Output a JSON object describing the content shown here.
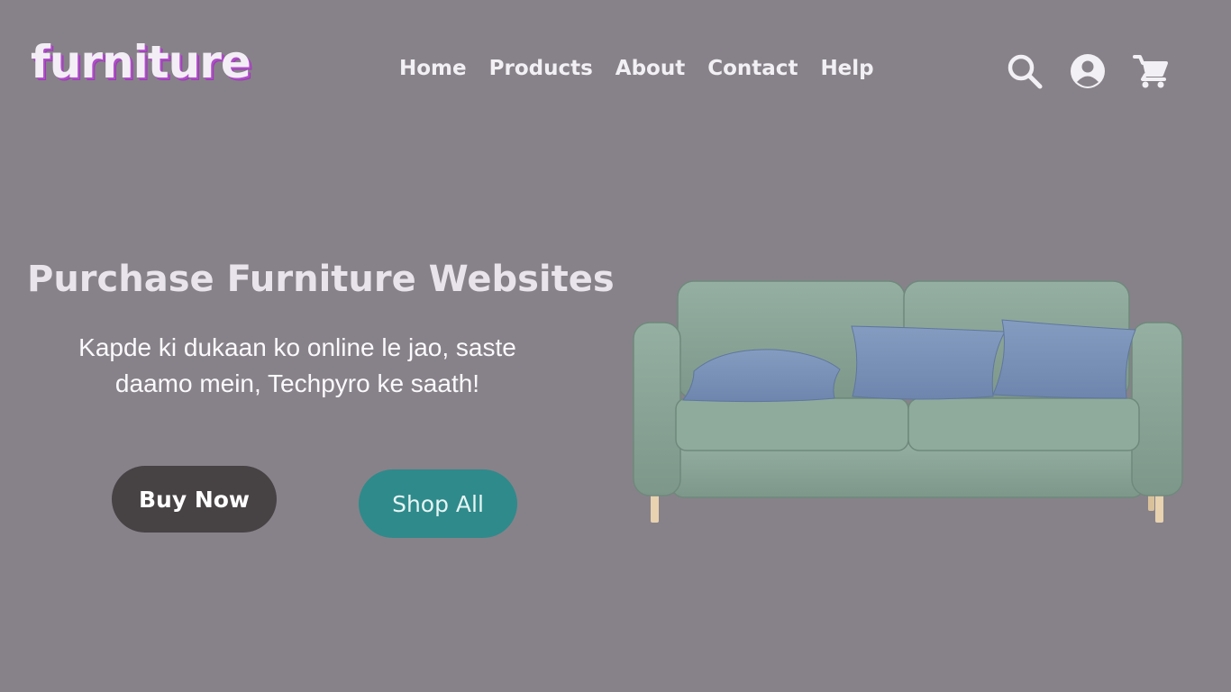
{
  "brand": {
    "logo_text": "furniture"
  },
  "nav": {
    "items": [
      {
        "label": "Home"
      },
      {
        "label": "Products"
      },
      {
        "label": "About"
      },
      {
        "label": "Contact"
      },
      {
        "label": "Help"
      }
    ]
  },
  "header_icons": [
    "search-icon",
    "account-icon",
    "cart-icon"
  ],
  "hero": {
    "title": "Purchase Furniture Websites",
    "subtitle_line1": "Kapde ki dukaan ko online le jao, saste",
    "subtitle_line2": "daamo mein, Techpyro ke saath!",
    "buy_label": "Buy Now",
    "shop_label": "Shop All"
  },
  "colors": {
    "background": "#878289",
    "logo_accent": "#b04fc8",
    "buy_button": "#474244",
    "shop_button": "#2f8a8b",
    "sofa_body": "#8aa598",
    "cushion": "#7b93b9"
  }
}
